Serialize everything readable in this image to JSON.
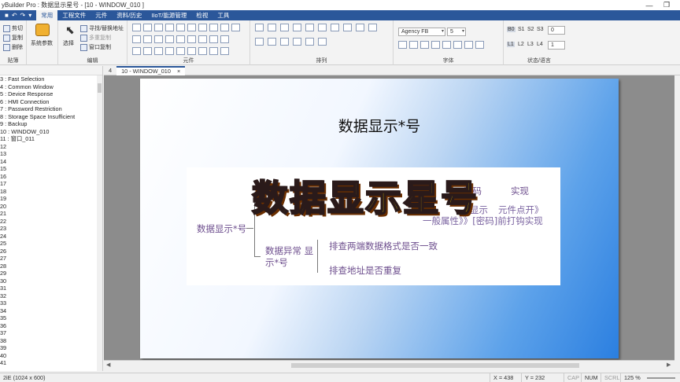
{
  "window": {
    "title": "yBuilder Pro : 数据显示星号 - [10 - WINDOW_010 ]",
    "minimize": "—",
    "restore": "❐"
  },
  "menubar": {
    "quick_access": [
      "■",
      "↶",
      "↷",
      "▾"
    ],
    "items": [
      "常用",
      "工程文件",
      "元件",
      "资料/历史",
      "IIoT/能源管理",
      "检视",
      "工具"
    ]
  },
  "ribbon": {
    "clipboard": {
      "cut": "剪切",
      "copy": "复制",
      "delete": "删除",
      "label": "贴簿"
    },
    "system_params": "系统参数",
    "edit": {
      "select": "选择",
      "find_replace": "寻找/替换地址",
      "multi_copy": "多重复制",
      "window_copy": "窗口复制",
      "label": "编辑"
    },
    "components_label": "元件",
    "arrange_label": "排列",
    "font": {
      "family": "Agency FB",
      "size": "5",
      "label": "字体"
    },
    "state": {
      "b0": "B0",
      "s1": "S1",
      "s2": "S2",
      "s3": "S3",
      "state_value": "0",
      "l1": "L1",
      "l2": "L2",
      "l3": "L3",
      "l4": "L4",
      "lang_value": "1",
      "label": "状态/语言"
    }
  },
  "left_panel": {
    "items": [
      "3 : Fast Selection",
      "4 : Common Window",
      "5 : Device Response",
      "6 : HMI Connection",
      "7 : Password Restriction",
      "8 : Storage Space Insufficient",
      "9 : Backup",
      "10 : WINDOW_010",
      "11 : 窗口_011",
      "12",
      "13",
      "14",
      "15",
      "16",
      "17",
      "18",
      "19",
      "20",
      "21",
      "22",
      "23",
      "24",
      "25",
      "26",
      "27",
      "28",
      "29",
      "30",
      "31",
      "32",
      "33",
      "34",
      "35",
      "36",
      "37",
      "38",
      "39",
      "40",
      "41"
    ]
  },
  "tabs": {
    "number": "4",
    "active": "10 - WINDOW_010",
    "close": "×"
  },
  "canvas": {
    "screen_title": "数据显示*号",
    "overlay_title": "数据显示星号",
    "mindmap": {
      "root": "数据显示*号",
      "top_right_1": "确",
      "top_right_2": "密码",
      "top_right_3": "实现",
      "faded_1": "显示",
      "faded_2": "元件点开》",
      "faded_3": "一般属性》》[密码]前打钩实现",
      "branch_line1": "数据异常 显",
      "branch_line2": "示*号",
      "leaf1": "排查两端数据格式是否一致",
      "leaf2": "排查地址是否重复"
    }
  },
  "statusbar": {
    "model": "2iE (1024 x 600)",
    "x": "X = 438",
    "y": "Y = 232",
    "cap": "CAP",
    "num": "NUM",
    "scrl": "SCRL",
    "zoom": "125 %"
  }
}
